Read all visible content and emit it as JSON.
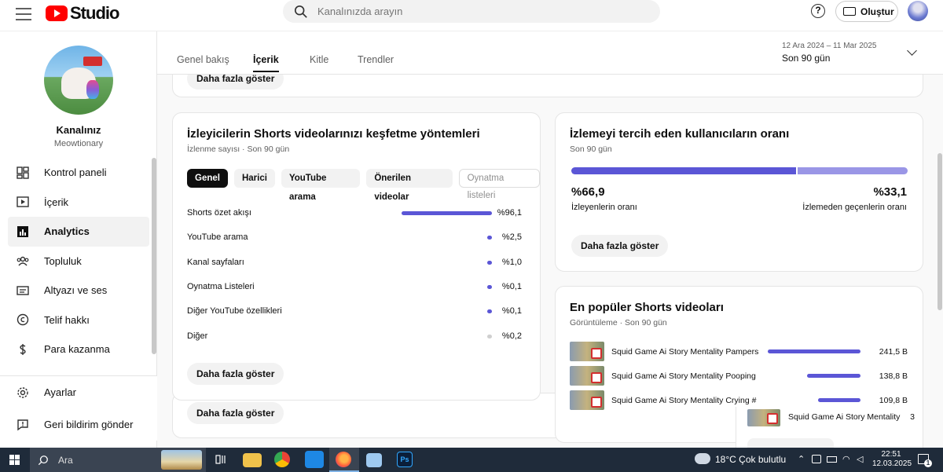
{
  "header": {
    "logo_text": "Studio",
    "search_placeholder": "Kanalınızda arayın",
    "help_label": "?",
    "create_label": "Oluştur"
  },
  "sidebar": {
    "channel_name": "Kanalınız",
    "channel_handle": "Meowtionary",
    "items": [
      {
        "label": "Kontrol paneli",
        "icon": "dashboard-icon"
      },
      {
        "label": "İçerik",
        "icon": "content-icon"
      },
      {
        "label": "Analytics",
        "icon": "analytics-icon",
        "active": true
      },
      {
        "label": "Topluluk",
        "icon": "community-icon"
      },
      {
        "label": "Altyazı ve ses",
        "icon": "subtitles-icon"
      },
      {
        "label": "Telif hakkı",
        "icon": "copyright-icon"
      },
      {
        "label": "Para kazanma",
        "icon": "dollar-icon"
      }
    ],
    "bottom_items": [
      {
        "label": "Ayarlar",
        "icon": "gear-icon"
      },
      {
        "label": "Geri bildirim gönder",
        "icon": "feedback-icon"
      }
    ]
  },
  "tabs": [
    {
      "label": "Genel bakış"
    },
    {
      "label": "İçerik",
      "active": true
    },
    {
      "label": "Kitle"
    },
    {
      "label": "Trendler"
    }
  ],
  "date": {
    "range": "12 Ara 2024 – 11 Mar 2025",
    "label": "Son 90 gün"
  },
  "discovery_card": {
    "title": "İzleyicilerin Shorts videolarınızı keşfetme yöntemleri",
    "subtitle": "İzlenme sayısı · Son 90 gün",
    "chips": [
      "Genel",
      "Harici",
      "YouTube arama",
      "Önerilen videolar",
      "Oynatma listeleri"
    ],
    "rows": [
      {
        "label": "Shorts özet akışı",
        "value": "%96,1",
        "share": 96.1
      },
      {
        "label": "YouTube arama",
        "value": "%2,5",
        "share": 2.5
      },
      {
        "label": "Kanal sayfaları",
        "value": "%1,0",
        "share": 1.0
      },
      {
        "label": "Oynatma Listeleri",
        "value": "%0,1",
        "share": 0.1
      },
      {
        "label": "Diğer YouTube özellikleri",
        "value": "%0,1",
        "share": 0.1
      },
      {
        "label": "Diğer",
        "value": "%0,2",
        "share": 0.2
      }
    ],
    "more_button": "Daha fazla göster"
  },
  "ratio_card": {
    "title": "İzlemeyi tercih eden kullanıcıların oranı",
    "subtitle": "Son 90 gün",
    "watched_value": "%66,9",
    "watched_label": "İzleyenlerin oranı",
    "skipped_value": "%33,1",
    "skipped_label": "İzlemeden geçenlerin oranı",
    "watched_share": 66.9,
    "more_button": "Daha fazla göster"
  },
  "popular_card": {
    "title": "En popüler Shorts videoları",
    "subtitle": "Görüntüleme · Son 90 gün",
    "rows": [
      {
        "title": "Squid Game Ai Story Mentality Pampers",
        "value": "241,5 B",
        "amount": 241.5
      },
      {
        "title": "Squid Game Ai Story Mentality Pooping",
        "value": "138,8 B",
        "amount": 138.8
      },
      {
        "title": "Squid Game Ai Story Mentality Crying #",
        "value": "109,8 B",
        "amount": 109.8
      }
    ],
    "overflow_row": {
      "title": "Squid Game Ai Story Mentality",
      "value": "3"
    }
  },
  "behind_buttons": {
    "top": "Daha fazla göster",
    "bottom": "Daha fazla göster"
  },
  "taskbar": {
    "search_label": "Ara",
    "weather": "18°C  Çok bulutlu",
    "time": "22:51",
    "date": "12.03.2025",
    "notification_count": "1"
  }
}
